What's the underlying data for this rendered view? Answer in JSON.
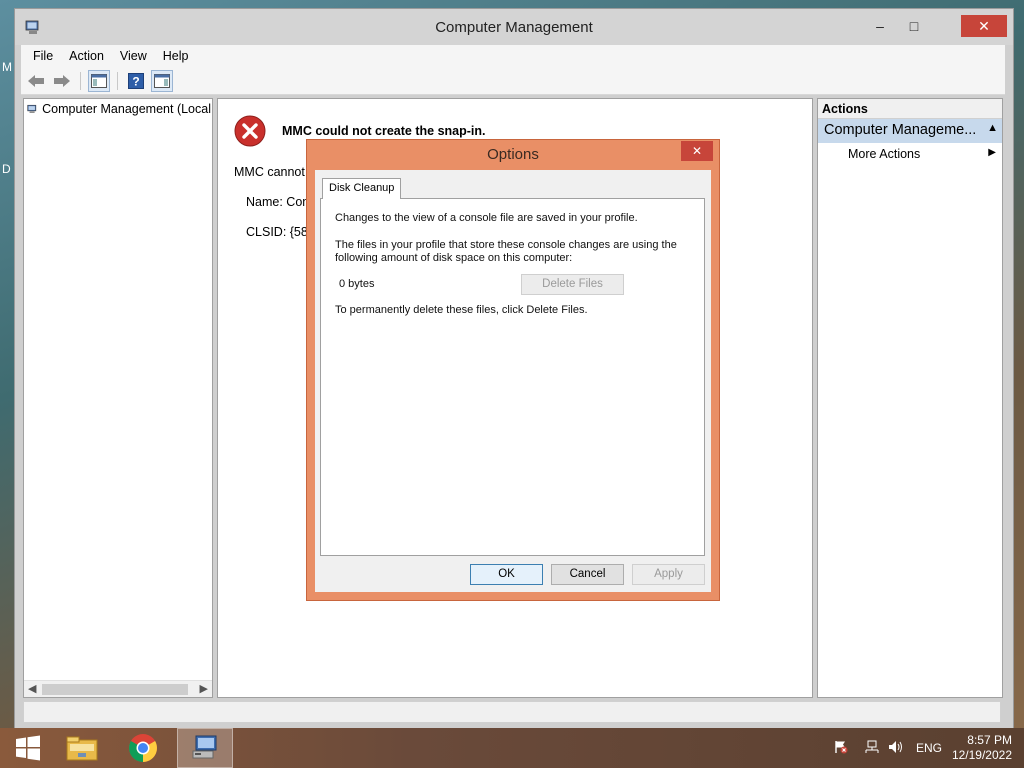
{
  "desktop": {
    "edge_labels": [
      "M",
      "D"
    ]
  },
  "window": {
    "title": "Computer Management",
    "controls": {
      "minimize": "–",
      "maximize": "□",
      "close": "✕"
    }
  },
  "menu": [
    "File",
    "Action",
    "View",
    "Help"
  ],
  "toolbar": [
    "back-icon",
    "forward-icon",
    "show-hide-tree-icon",
    "help-icon",
    "show-hide-action-pane-icon"
  ],
  "tree": {
    "root_label": "Computer Management (Local"
  },
  "center": {
    "error_title": "MMC could not create the snap-in.",
    "line1": "MMC cannot",
    "name_line": "Name: Com",
    "clsid_line": "CLSID: {5822"
  },
  "actions": {
    "header": "Actions",
    "section": "Computer Manageme...",
    "items": [
      "More Actions"
    ]
  },
  "dialog": {
    "title": "Options",
    "close": "✕",
    "tab": "Disk Cleanup",
    "text1": "Changes to the view of a console file are saved in your profile.",
    "text2a": "The files in your profile that store these console changes are using the",
    "text2b": "following amount of disk space on this computer:",
    "size": "0 bytes",
    "delete_button": "Delete Files",
    "text3": "To permanently delete these files, click Delete Files.",
    "ok": "OK",
    "cancel": "Cancel",
    "apply": "Apply"
  },
  "taskbar": {
    "apps": [
      "start-icon",
      "file-explorer-icon",
      "chrome-icon",
      "computer-management-icon"
    ],
    "tray": {
      "lang": "ENG"
    },
    "time": "8:57 PM",
    "date": "12/19/2022"
  },
  "colors": {
    "dialog_frame": "#e98f66",
    "close_red": "#c7453a",
    "actions_highlight": "#c7d9ec"
  }
}
